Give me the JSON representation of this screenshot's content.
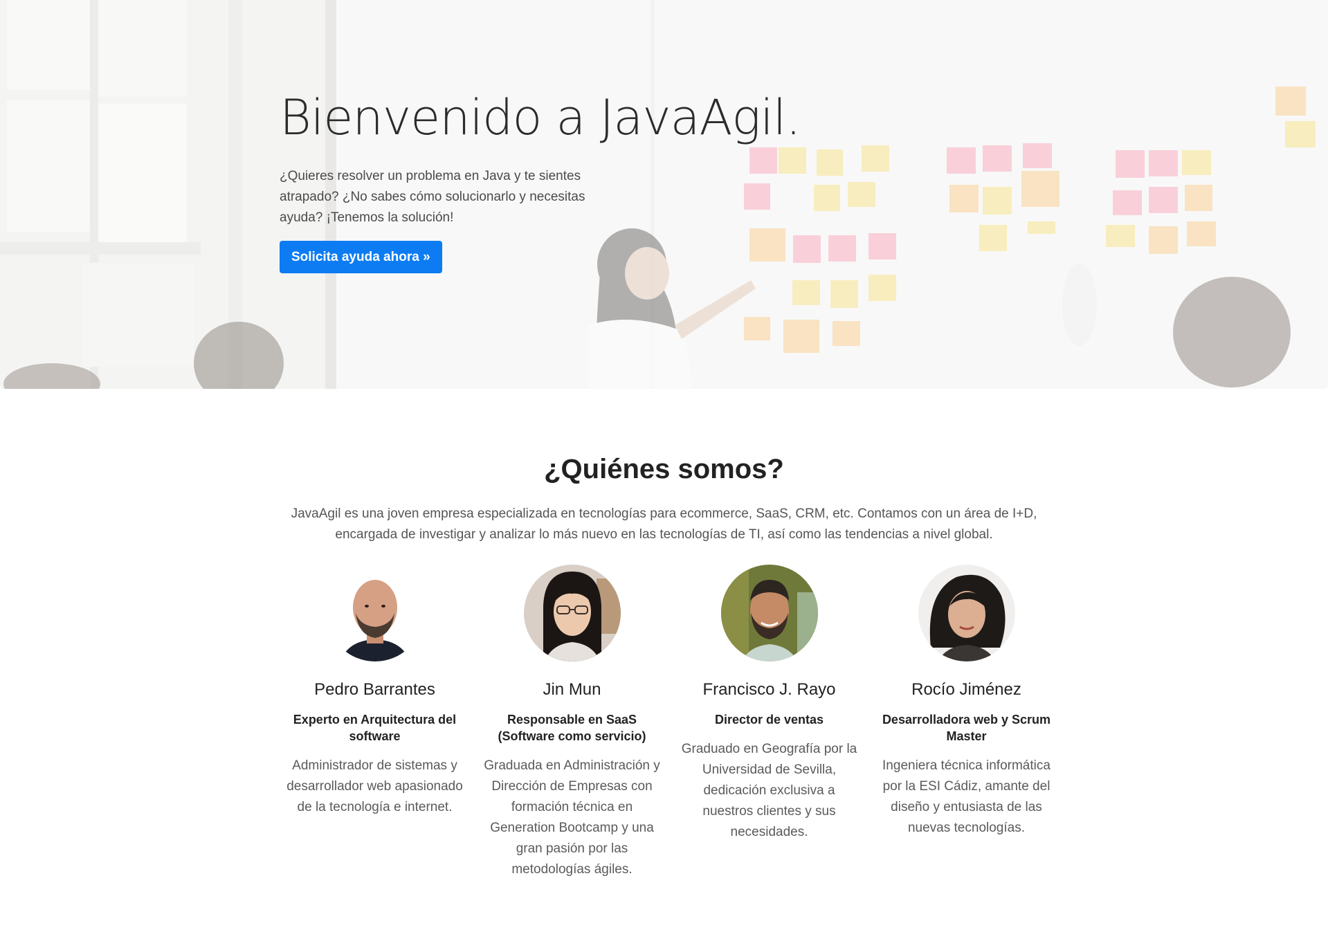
{
  "hero": {
    "title": "Bienvenido a JavaAgil.",
    "lead": "¿Quieres resolver un problema en Java y te sientes atrapado? ¿No sabes cómo solucionarlo y necesitas ayuda?  ¡Tenemos la solución!",
    "cta_label": "Solicita ayuda ahora »",
    "cta_color": "#0d7cf2"
  },
  "about": {
    "title": "¿Quiénes somos?",
    "description": "JavaAgil es una joven empresa especializada en tecnologías para ecommerce, SaaS, CRM, etc. Contamos con un área de I+D, encargada de investigar y analizar lo más nuevo en las tecnologías de TI, así como las tendencias a nivel global."
  },
  "team": [
    {
      "name": "Pedro Barrantes",
      "role": "Experto en Arquitectura del software",
      "bio": "Administrador de sistemas y desarrollador web apasionado de la tecnología e internet."
    },
    {
      "name": "Jin Mun",
      "role": "Responsable en SaaS (Software como servicio)",
      "bio": "Graduada en Administración y Dirección de Empresas con formación técnica en Generation Bootcamp y una gran pasión por las metodologías ágiles."
    },
    {
      "name": "Francisco J. Rayo",
      "role": "Director de ventas",
      "bio": "Graduado en Geografía por la Universidad de Sevilla, dedicación exclusiva a nuestros clientes y sus necesidades."
    },
    {
      "name": "Rocío Jiménez",
      "role": "Desarrolladora web y Scrum Master",
      "bio": "Ingeniera técnica informática por la ESI Cádiz, amante del diseño y entusiasta de las nuevas tecnologías."
    }
  ]
}
